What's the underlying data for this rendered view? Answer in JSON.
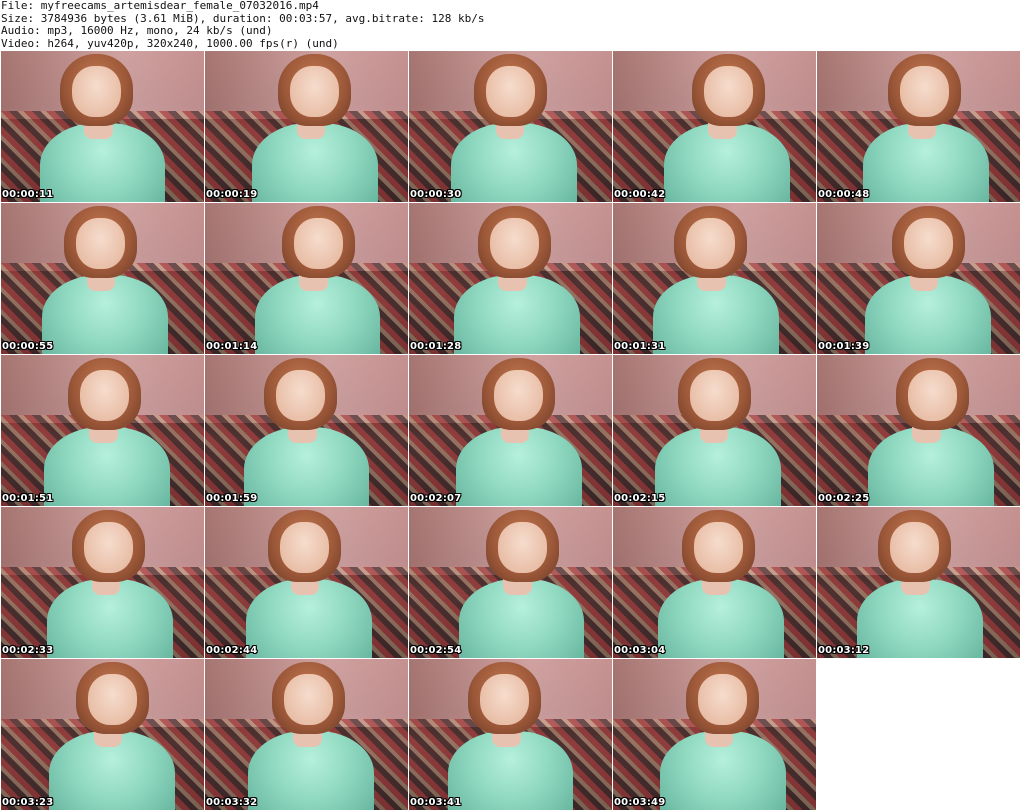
{
  "header": {
    "file": "File: myfreecams_artemisdear_female_07032016.mp4",
    "size": "Size: 3784936 bytes (3.61 MiB), duration: 00:03:57, avg.bitrate: 128 kb/s",
    "audio": "Audio: mp3, 16000 Hz, mono, 24 kb/s (und)",
    "video": "Video: h264, yuv420p, 320x240, 1000.00 fps(r) (und)"
  },
  "thumbnails": [
    {
      "time": "00:00:11"
    },
    {
      "time": "00:00:19"
    },
    {
      "time": "00:00:30"
    },
    {
      "time": "00:00:42"
    },
    {
      "time": "00:00:48"
    },
    {
      "time": "00:00:55"
    },
    {
      "time": "00:01:14"
    },
    {
      "time": "00:01:28"
    },
    {
      "time": "00:01:31"
    },
    {
      "time": "00:01:39"
    },
    {
      "time": "00:01:51"
    },
    {
      "time": "00:01:59"
    },
    {
      "time": "00:02:07"
    },
    {
      "time": "00:02:15"
    },
    {
      "time": "00:02:25"
    },
    {
      "time": "00:02:33"
    },
    {
      "time": "00:02:44"
    },
    {
      "time": "00:02:54"
    },
    {
      "time": "00:03:04"
    },
    {
      "time": "00:03:12"
    },
    {
      "time": "00:03:23"
    },
    {
      "time": "00:03:32"
    },
    {
      "time": "00:03:41"
    },
    {
      "time": "00:03:49"
    }
  ]
}
